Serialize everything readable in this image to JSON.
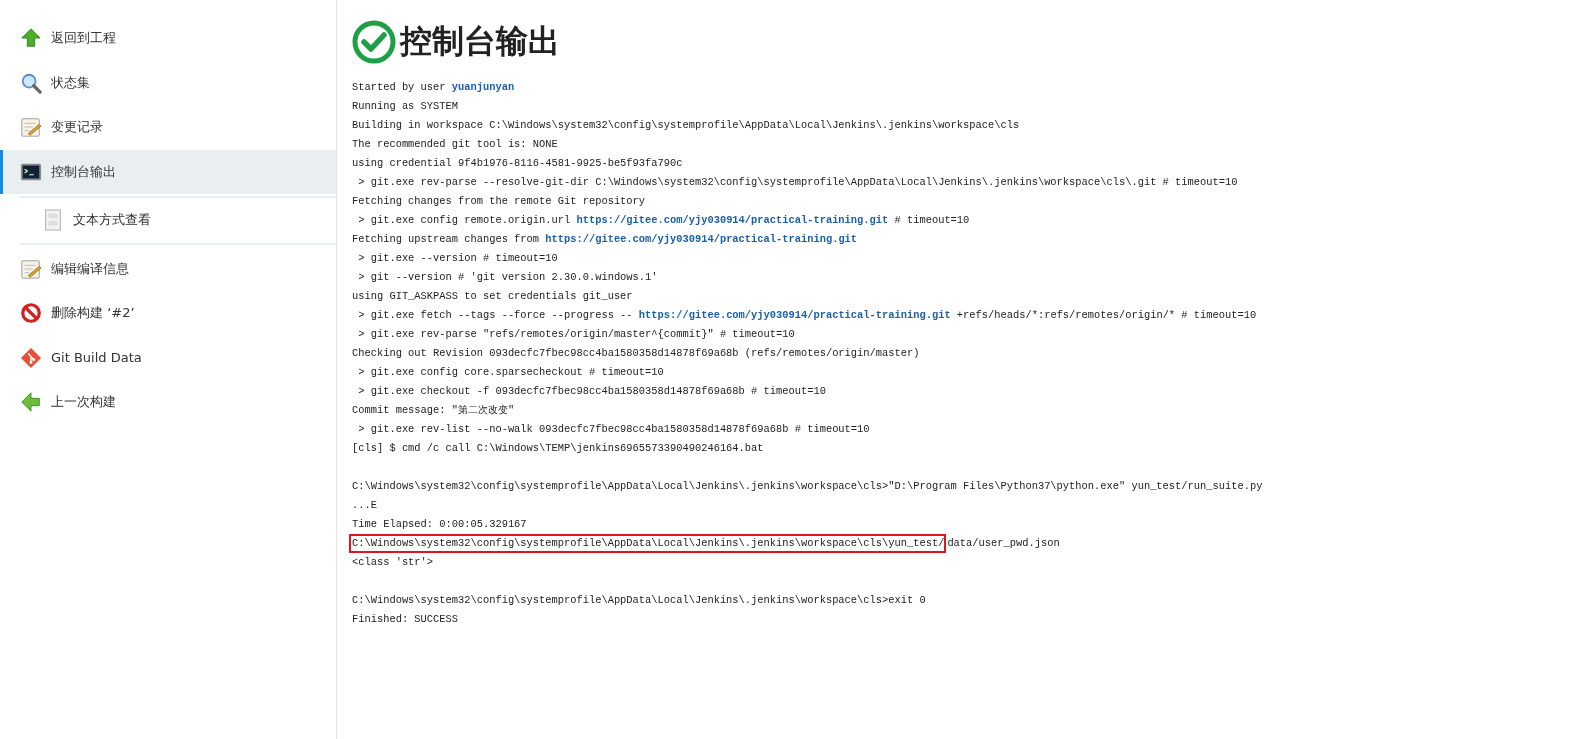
{
  "sidebar": {
    "items": [
      {
        "label": "返回到工程",
        "selected": false
      },
      {
        "label": "状态集",
        "selected": false
      },
      {
        "label": "变更记录",
        "selected": false
      },
      {
        "label": "控制台输出",
        "selected": true,
        "children": [
          {
            "label": "文本方式查看",
            "selected": false
          }
        ]
      },
      {
        "label": "编辑编译信息",
        "selected": false
      },
      {
        "label": "删除构建 ‘#2’",
        "selected": false
      },
      {
        "label": "Git Build Data",
        "selected": false
      },
      {
        "label": "上一次构建",
        "selected": false
      }
    ]
  },
  "page": {
    "title": "控制台输出",
    "console": [
      {
        "kind": "line",
        "segments": [
          {
            "kind": "text",
            "text": "Started by user "
          },
          {
            "kind": "link",
            "text": "yuanjunyan"
          }
        ]
      },
      {
        "kind": "line",
        "segments": [
          {
            "kind": "text",
            "text": "Running as SYSTEM"
          }
        ]
      },
      {
        "kind": "line",
        "segments": [
          {
            "kind": "text",
            "text": "Building in workspace C:\\Windows\\system32\\config\\systemprofile\\AppData\\Local\\Jenkins\\.jenkins\\workspace\\cls"
          }
        ]
      },
      {
        "kind": "line",
        "segments": [
          {
            "kind": "text",
            "text": "The recommended git tool is: NONE"
          }
        ]
      },
      {
        "kind": "line",
        "segments": [
          {
            "kind": "text",
            "text": "using credential 9f4b1976-8116-4581-9925-be5f93fa790c"
          }
        ]
      },
      {
        "kind": "line",
        "segments": [
          {
            "kind": "text",
            "text": " > git.exe rev-parse --resolve-git-dir C:\\Windows\\system32\\config\\systemprofile\\AppData\\Local\\Jenkins\\.jenkins\\workspace\\cls\\.git # timeout=10"
          }
        ]
      },
      {
        "kind": "line",
        "segments": [
          {
            "kind": "text",
            "text": "Fetching changes from the remote Git repository"
          }
        ]
      },
      {
        "kind": "line",
        "segments": [
          {
            "kind": "text",
            "text": " > git.exe config remote.origin.url "
          },
          {
            "kind": "link",
            "text": "https://gitee.com/yjy030914/practical-training.git"
          },
          {
            "kind": "text",
            "text": " # timeout=10"
          }
        ]
      },
      {
        "kind": "line",
        "segments": [
          {
            "kind": "text",
            "text": "Fetching upstream changes from "
          },
          {
            "kind": "link",
            "text": "https://gitee.com/yjy030914/practical-training.git"
          }
        ]
      },
      {
        "kind": "line",
        "segments": [
          {
            "kind": "text",
            "text": " > git.exe --version # timeout=10"
          }
        ]
      },
      {
        "kind": "line",
        "segments": [
          {
            "kind": "text",
            "text": " > git --version # 'git version 2.30.0.windows.1'"
          }
        ]
      },
      {
        "kind": "line",
        "segments": [
          {
            "kind": "text",
            "text": "using GIT_ASKPASS to set credentials git_user"
          }
        ]
      },
      {
        "kind": "line",
        "segments": [
          {
            "kind": "text",
            "text": " > git.exe fetch --tags --force --progress -- "
          },
          {
            "kind": "link",
            "text": "https://gitee.com/yjy030914/practical-training.git"
          },
          {
            "kind": "text",
            "text": " +refs/heads/*:refs/remotes/origin/* # timeout=10"
          }
        ]
      },
      {
        "kind": "line",
        "segments": [
          {
            "kind": "text",
            "text": " > git.exe rev-parse \"refs/remotes/origin/master^{commit}\" # timeout=10"
          }
        ]
      },
      {
        "kind": "line",
        "segments": [
          {
            "kind": "text",
            "text": "Checking out Revision 093decfc7fbec98cc4ba1580358d14878f69a68b (refs/remotes/origin/master)"
          }
        ]
      },
      {
        "kind": "line",
        "segments": [
          {
            "kind": "text",
            "text": " > git.exe config core.sparsecheckout # timeout=10"
          }
        ]
      },
      {
        "kind": "line",
        "segments": [
          {
            "kind": "text",
            "text": " > git.exe checkout -f 093decfc7fbec98cc4ba1580358d14878f69a68b # timeout=10"
          }
        ]
      },
      {
        "kind": "line",
        "segments": [
          {
            "kind": "text",
            "text": "Commit message: \"第二次改变\""
          }
        ]
      },
      {
        "kind": "line",
        "segments": [
          {
            "kind": "text",
            "text": " > git.exe rev-list --no-walk 093decfc7fbec98cc4ba1580358d14878f69a68b # timeout=10"
          }
        ]
      },
      {
        "kind": "line",
        "segments": [
          {
            "kind": "text",
            "text": "[cls] $ cmd /c call C:\\Windows\\TEMP\\jenkins6965573390490246164.bat"
          }
        ]
      },
      {
        "kind": "blank"
      },
      {
        "kind": "line",
        "segments": [
          {
            "kind": "text",
            "text": "C:\\Windows\\system32\\config\\systemprofile\\AppData\\Local\\Jenkins\\.jenkins\\workspace\\cls>\"D:\\Program Files\\Python37\\python.exe\" yun_test/run_suite.py"
          }
        ]
      },
      {
        "kind": "line",
        "segments": [
          {
            "kind": "text",
            "text": "...E"
          }
        ]
      },
      {
        "kind": "line",
        "segments": [
          {
            "kind": "text",
            "text": "Time Elapsed: 0:00:05.329167"
          }
        ]
      },
      {
        "kind": "line",
        "segments": [
          {
            "kind": "boxed",
            "text": "C:\\Windows\\system32\\config\\systemprofile\\AppData\\Local\\Jenkins\\.jenkins\\workspace\\cls\\yun_test/"
          },
          {
            "kind": "text",
            "text": "data/user_pwd.json"
          }
        ]
      },
      {
        "kind": "line",
        "segments": [
          {
            "kind": "text",
            "text": "<class 'str'>"
          }
        ]
      },
      {
        "kind": "blank"
      },
      {
        "kind": "line",
        "segments": [
          {
            "kind": "text",
            "text": "C:\\Windows\\system32\\config\\systemprofile\\AppData\\Local\\Jenkins\\.jenkins\\workspace\\cls>exit 0"
          }
        ]
      },
      {
        "kind": "line",
        "segments": [
          {
            "kind": "text",
            "text": "Finished: SUCCESS"
          }
        ]
      }
    ]
  }
}
